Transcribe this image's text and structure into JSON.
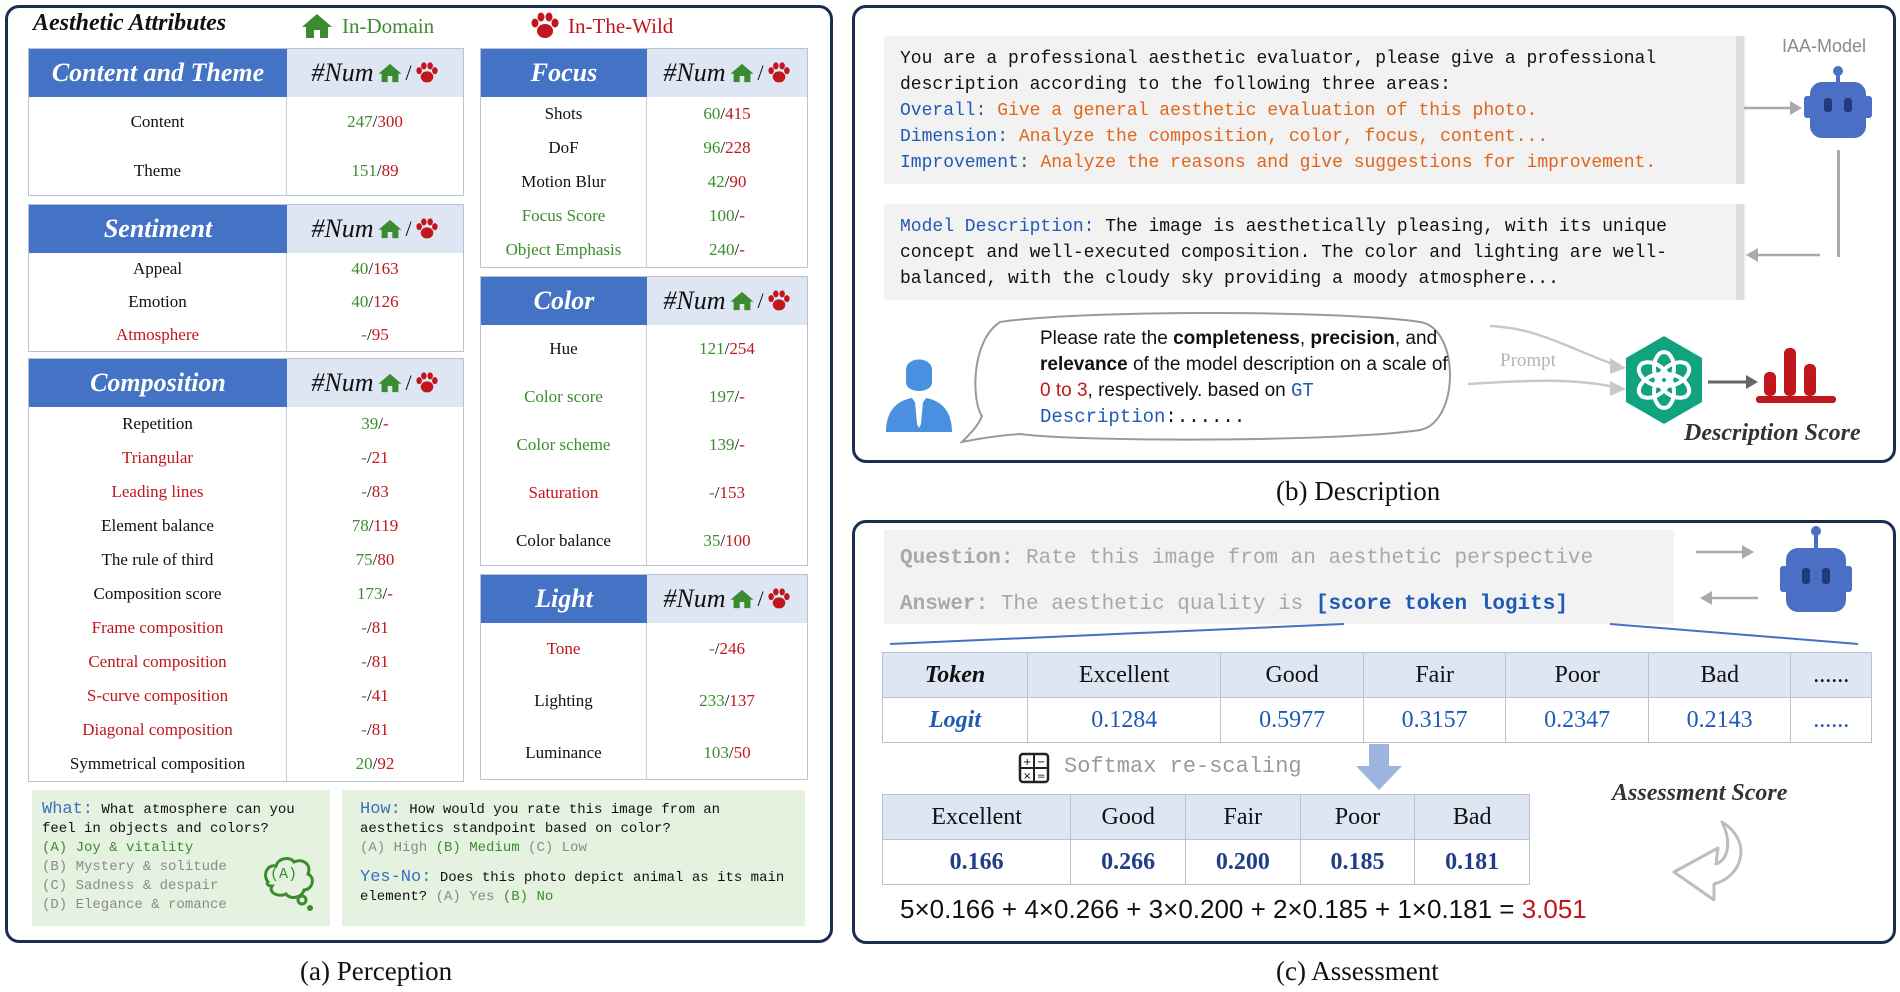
{
  "perception": {
    "title": "Aesthetic Attributes",
    "legend_in_domain": "In-Domain",
    "legend_in_wild": "In-The-Wild",
    "num_label": "#Num",
    "caption": "(a) Perception",
    "tables": {
      "content_theme": {
        "name": "Content and Theme",
        "rows": [
          {
            "label": "Content",
            "a": "247",
            "b": "300",
            "lc": "black"
          },
          {
            "label": "Theme",
            "a": "151",
            "b": "89",
            "lc": "black"
          }
        ]
      },
      "sentiment": {
        "name": "Sentiment",
        "rows": [
          {
            "label": "Appeal",
            "a": "40",
            "b": "163",
            "lc": "black"
          },
          {
            "label": "Emotion",
            "a": "40",
            "b": "126",
            "lc": "black"
          },
          {
            "label": "Atmosphere",
            "a": "-",
            "b": "95",
            "lc": "red"
          }
        ]
      },
      "composition": {
        "name": "Composition",
        "rows": [
          {
            "label": "Repetition",
            "a": "39",
            "b": "-",
            "lc": "black"
          },
          {
            "label": "Triangular",
            "a": "-",
            "b": "21",
            "lc": "red"
          },
          {
            "label": "Leading lines",
            "a": "-",
            "b": "83",
            "lc": "red"
          },
          {
            "label": "Element balance",
            "a": "78",
            "b": "119",
            "lc": "black"
          },
          {
            "label": "The rule of third",
            "a": "75",
            "b": "80",
            "lc": "black"
          },
          {
            "label": "Composition score",
            "a": "173",
            "b": "-",
            "lc": "black"
          },
          {
            "label": "Frame composition",
            "a": "-",
            "b": "81",
            "lc": "red"
          },
          {
            "label": "Central composition",
            "a": "-",
            "b": "81",
            "lc": "red"
          },
          {
            "label": "S-curve composition",
            "a": "-",
            "b": "41",
            "lc": "red"
          },
          {
            "label": "Diagonal composition",
            "a": "-",
            "b": "81",
            "lc": "red"
          },
          {
            "label": "Symmetrical composition",
            "a": "20",
            "b": "92",
            "lc": "black"
          }
        ]
      },
      "focus": {
        "name": "Focus",
        "rows": [
          {
            "label": "Shots",
            "a": "60",
            "b": "415",
            "lc": "black"
          },
          {
            "label": "DoF",
            "a": "96",
            "b": "228",
            "lc": "black"
          },
          {
            "label": "Motion Blur",
            "a": "42",
            "b": "90",
            "lc": "black"
          },
          {
            "label": "Focus Score",
            "a": "100",
            "b": "-",
            "lc": "green"
          },
          {
            "label": "Object Emphasis",
            "a": "240",
            "b": "-",
            "lc": "green"
          }
        ]
      },
      "color": {
        "name": "Color",
        "rows": [
          {
            "label": "Hue",
            "a": "121",
            "b": "254",
            "lc": "black"
          },
          {
            "label": "Color score",
            "a": "197",
            "b": "-",
            "lc": "green"
          },
          {
            "label": "Color scheme",
            "a": "139",
            "b": "-",
            "lc": "green"
          },
          {
            "label": "Saturation",
            "a": "-",
            "b": "153",
            "lc": "red"
          },
          {
            "label": "Color balance",
            "a": "35",
            "b": "100",
            "lc": "black"
          }
        ]
      },
      "light": {
        "name": "Light",
        "rows": [
          {
            "label": "Tone",
            "a": "-",
            "b": "246",
            "lc": "red"
          },
          {
            "label": "Lighting",
            "a": "233",
            "b": "137",
            "lc": "black"
          },
          {
            "label": "Luminance",
            "a": "103",
            "b": "50",
            "lc": "black"
          }
        ]
      }
    },
    "what_box": {
      "what_key": "What:",
      "what_q": "What atmosphere can you feel in objects and colors?",
      "options": [
        "(A) Joy & vitality",
        "(B) Mystery & solitude",
        "(C) Sadness & despair",
        "(D) Elegance & romance"
      ],
      "badge": "(A)"
    },
    "how_box": {
      "how_key": "How:",
      "how_q": "How would you rate this image from an aesthetics standpoint based on color?",
      "opt_a": "(A) High",
      "opt_b": "(B) Medium",
      "opt_c": "(C) Low",
      "yn_key": "Yes-No:",
      "yn_q": "Does this photo depict animal as its main element?",
      "yn_a": "(A) Yes",
      "yn_b": "(B) No"
    }
  },
  "description": {
    "caption": "(b) Description",
    "model_label": "IAA-Model",
    "prompt_intro": "You are a professional aesthetic evaluator, please give a professional description according to the following three areas:",
    "overall_key": "Overall:",
    "overall_val": "Give a general aesthetic evaluation of this photo.",
    "dimension_key": "Dimension:",
    "dimension_val": "Analyze the composition, color, focus, content...",
    "improvement_key": "Improvement:",
    "improvement_val": "Analyze the reasons and give suggestions for improvement.",
    "model_desc_key": "Model Description:",
    "model_desc_val": "The image is aesthetically pleasing, with its unique concept and well-executed composition. The color and lighting are well-balanced, with the cloudy sky providing a moody atmosphere...",
    "bubble_p1": "Please rate the ",
    "bubble_b1": "completeness",
    "bubble_p2": ", ",
    "bubble_b2": "precision",
    "bubble_p3": ", and ",
    "bubble_b3": "relevance",
    "bubble_p4": " of the model description on a scale of ",
    "bubble_range": "0 to 3",
    "bubble_p5": ", respectively. based on ",
    "bubble_gt": "GT Description",
    "bubble_end": ":......",
    "prompt_arrow_label": "Prompt",
    "score_label": "Description Score"
  },
  "assessment": {
    "caption": "(c) Assessment",
    "question_key": "Question:",
    "question_val": "Rate this image from an aesthetic perspective",
    "answer_key": "Answer:",
    "answer_val": "The aesthetic quality is",
    "answer_token": "[score token logits]",
    "token_header": "Token",
    "logit_header": "Logit",
    "tokens": [
      "Excellent",
      "Good",
      "Fair",
      "Poor",
      "Bad",
      "......"
    ],
    "logits": [
      "0.1284",
      "0.5977",
      "0.3157",
      "0.2347",
      "0.2143",
      "......"
    ],
    "softmax_label": "Softmax re-scaling",
    "prob_tokens": [
      "Excellent",
      "Good",
      "Fair",
      "Poor",
      "Bad"
    ],
    "probs": [
      "0.166",
      "0.266",
      "0.200",
      "0.185",
      "0.181"
    ],
    "score_label": "Assessment Score",
    "formula": "5×0.166 + 4×0.266 + 3×0.200 + 2×0.185 + 1×0.181 = ",
    "result": "3.051"
  },
  "colors": {
    "header_blue": "#4472c4",
    "num_bg": "#dfe6f3",
    "frame": "#1c2e50",
    "green": "#3b8c2e",
    "red": "#c0161c",
    "teal": "#10a37f"
  }
}
